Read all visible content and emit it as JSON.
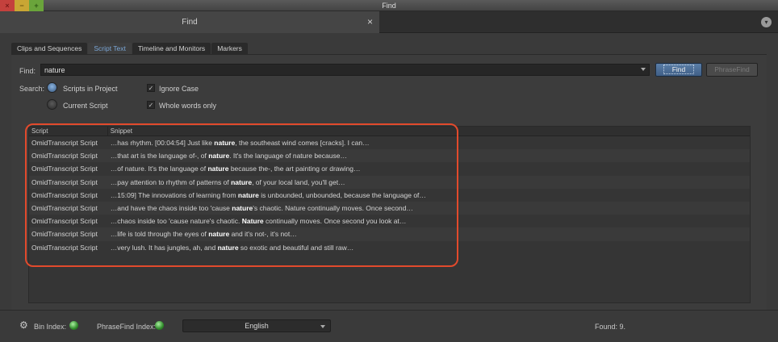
{
  "window": {
    "title": "Find",
    "close_glyph": "×",
    "min_glyph": "−",
    "max_glyph": "+"
  },
  "tab": {
    "title": "Find",
    "close_glyph": "×",
    "menu_icon": "menu-circle-icon"
  },
  "subtabs": [
    "Clips and Sequences",
    "Script Text",
    "Timeline and Monitors",
    "Markers"
  ],
  "active_subtab": "Script Text",
  "find": {
    "label": "Find:",
    "value": "nature",
    "find_button": "Find",
    "phrasefind_button": "PhraseFind"
  },
  "search": {
    "label": "Search:",
    "scripts_in_project": "Scripts in Project",
    "current_script": "Current Script",
    "ignore_case": "Ignore Case",
    "whole_words": "Whole words only",
    "selected_scope": "Scripts in Project",
    "ignore_case_checked": true,
    "whole_words_checked": true
  },
  "table": {
    "columns": [
      "Script",
      "Snippet"
    ],
    "rows": [
      {
        "script": "OmidTranscript Script",
        "pre": "…has rhythm. [00:04:54] Just like ",
        "match": "nature",
        "post": ", the southeast wind comes [cracks]. I can…"
      },
      {
        "script": "OmidTranscript Script",
        "pre": "…that art is the language of-, of ",
        "match": "nature",
        "post": ". It's the language of nature because…"
      },
      {
        "script": "OmidTranscript Script",
        "pre": "…of nature. It's the language of ",
        "match": "nature",
        "post": " because the-, the art painting or drawing…"
      },
      {
        "script": "OmidTranscript Script",
        "pre": "…pay attention to rhythm of patterns of ",
        "match": "nature",
        "post": ", of your local land, you'll get…"
      },
      {
        "script": "OmidTranscript Script",
        "pre": "…15:09] The innovations of learning from ",
        "match": "nature",
        "post": " is unbounded, unbounded, because the language of…"
      },
      {
        "script": "OmidTranscript Script",
        "pre": "…and have the chaos inside too 'cause ",
        "match": "nature",
        "post": "'s chaotic. Nature continually moves. Once second…"
      },
      {
        "script": "OmidTranscript Script",
        "pre": "…chaos inside too 'cause nature's chaotic. ",
        "match": "Nature",
        "post": " continually moves. Once second you look at…"
      },
      {
        "script": "OmidTranscript Script",
        "pre": "…life is told through the eyes of ",
        "match": "nature",
        "post": " and it's not-, it's not…"
      },
      {
        "script": "OmidTranscript Script",
        "pre": "…very lush. It has jungles, ah, and ",
        "match": "nature",
        "post": " so exotic and beautiful and still raw…"
      }
    ]
  },
  "footer": {
    "bin_index_label": "Bin Index:",
    "phrasefind_index_label": "PhraseFind Index:",
    "language": "English",
    "found": "Found: 9.",
    "led_color": "#3fb33a"
  },
  "colors": {
    "accent_tab": "#7aa6d6",
    "find_button": "#4b6e98",
    "annotation_outline": "#e24a2c"
  }
}
